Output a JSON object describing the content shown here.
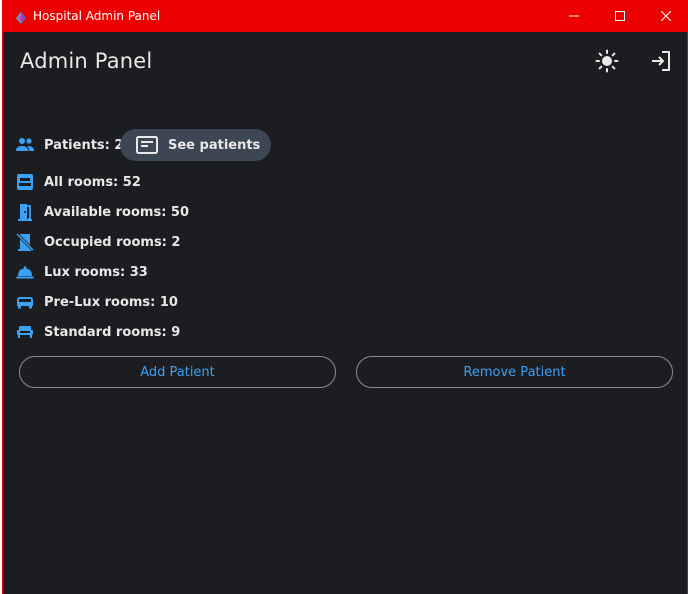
{
  "window": {
    "title": "Hospital Admin Panel",
    "controls": [
      "minimize-icon",
      "maximize-icon",
      "close-icon"
    ],
    "titlebar_color": "#ee0000"
  },
  "header": {
    "title": "Admin Panel",
    "icons": [
      "theme-toggle-icon",
      "logout-icon"
    ]
  },
  "stats": {
    "patients": {
      "label": "Patients: 2",
      "icon": "people-icon"
    },
    "all_rooms": {
      "label": "All rooms: 52",
      "icon": "bed-icon"
    },
    "available_rooms": {
      "label": "Available rooms: 50",
      "icon": "door-open-icon"
    },
    "occupied_rooms": {
      "label": "Occupied rooms: 2",
      "icon": "door-closed-crossed-icon"
    },
    "lux_rooms": {
      "label": "Lux rooms: 33",
      "icon": "room-service-icon"
    },
    "prelux_rooms": {
      "label": "Pre-Lux rooms: 10",
      "icon": "car-icon"
    },
    "standard_rooms": {
      "label": "Standard rooms: 9",
      "icon": "sofa-icon"
    }
  },
  "actions": {
    "see_patients": "See patients",
    "add_patient": "Add Patient",
    "remove_patient": "Remove Patient"
  },
  "colors": {
    "background": "#1c1d20",
    "accent": "#3ba1f4",
    "chip": "#3d4753",
    "text": "#e8e8e8"
  }
}
